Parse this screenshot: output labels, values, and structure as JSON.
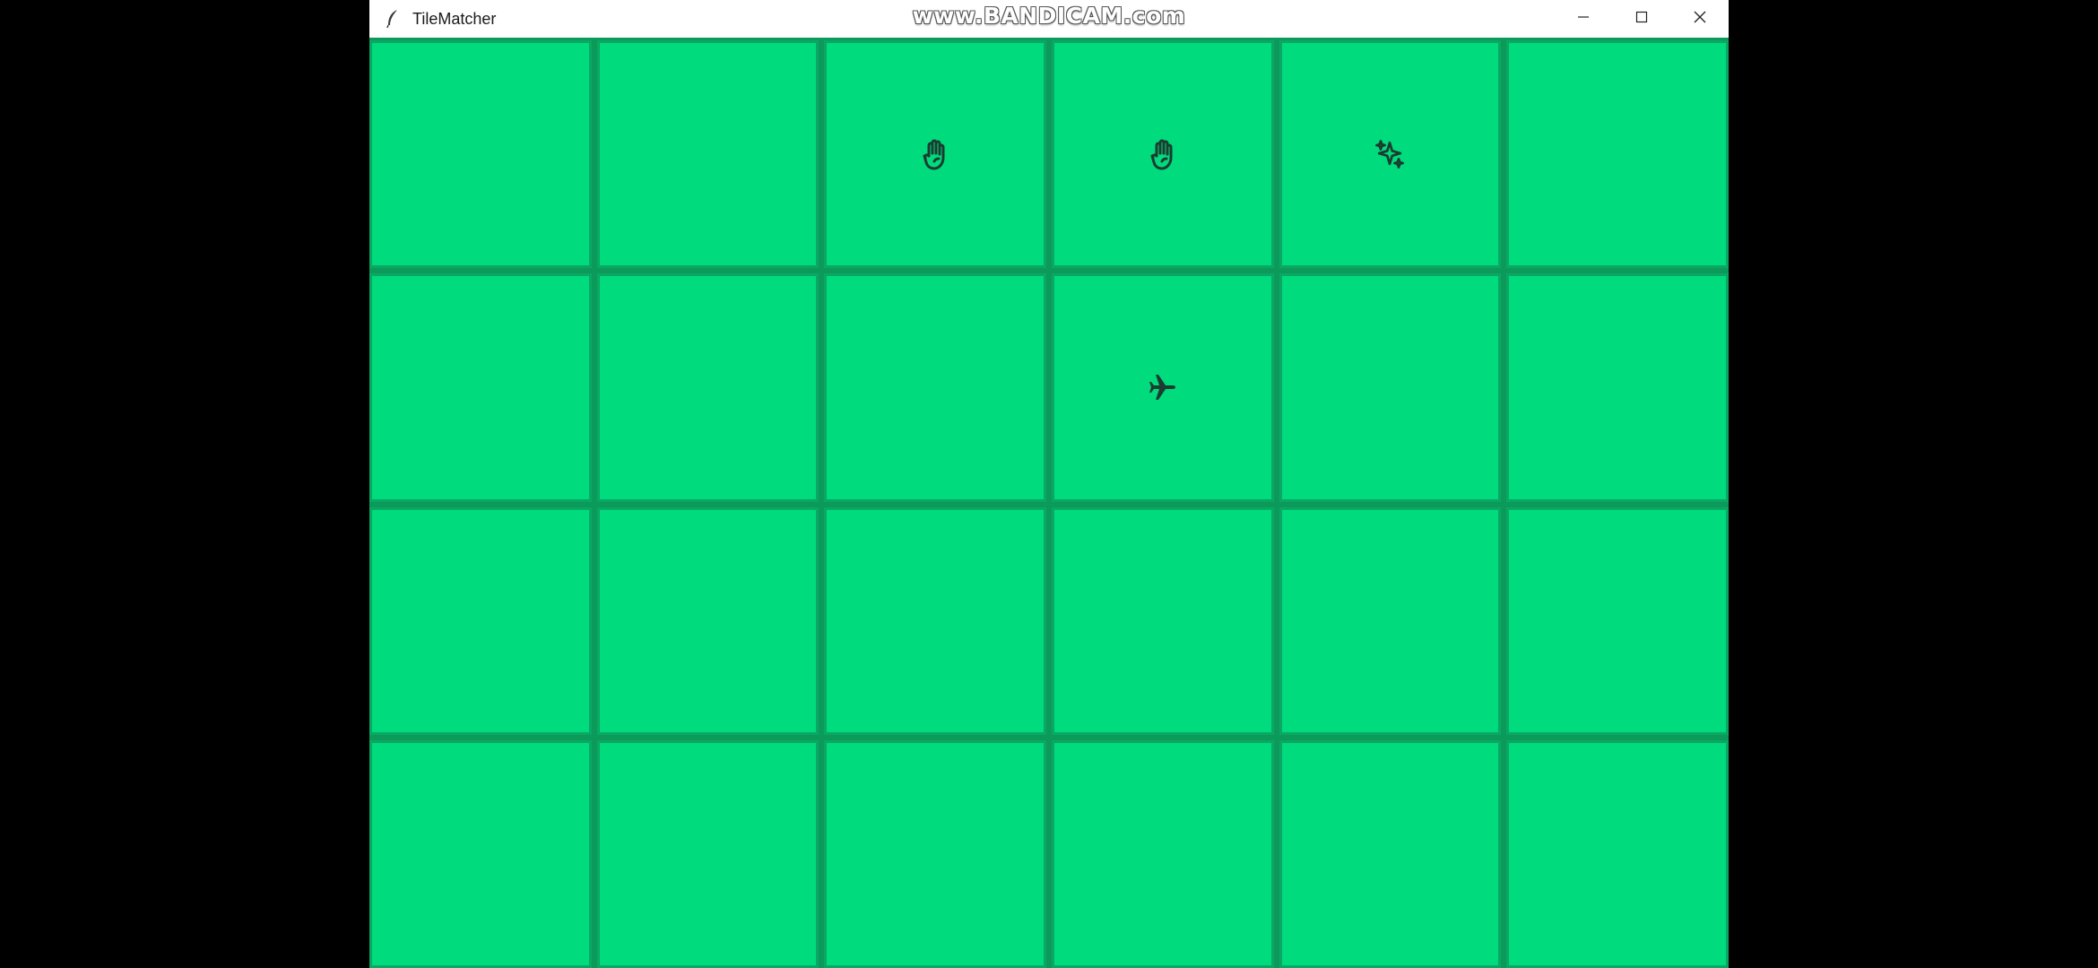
{
  "window": {
    "title": "TileMatcher",
    "watermark": "www.BANDICAM.com",
    "controls": [
      {
        "name": "minimize-button",
        "icon": "minimize-icon"
      },
      {
        "name": "maximize-button",
        "icon": "maximize-icon"
      },
      {
        "name": "close-button",
        "icon": "close-icon"
      }
    ]
  },
  "board": {
    "rows": 4,
    "columns": 6,
    "tile_color": "#00db7d",
    "border_color": "#0aa864",
    "tiles": [
      [
        "",
        "",
        "hand-icon",
        "hand-icon",
        "sparkles-icon",
        ""
      ],
      [
        "",
        "",
        "",
        "airplane-icon",
        "",
        ""
      ],
      [
        "",
        "",
        "",
        "",
        "",
        ""
      ],
      [
        "",
        "",
        "",
        "",
        "",
        ""
      ]
    ]
  }
}
